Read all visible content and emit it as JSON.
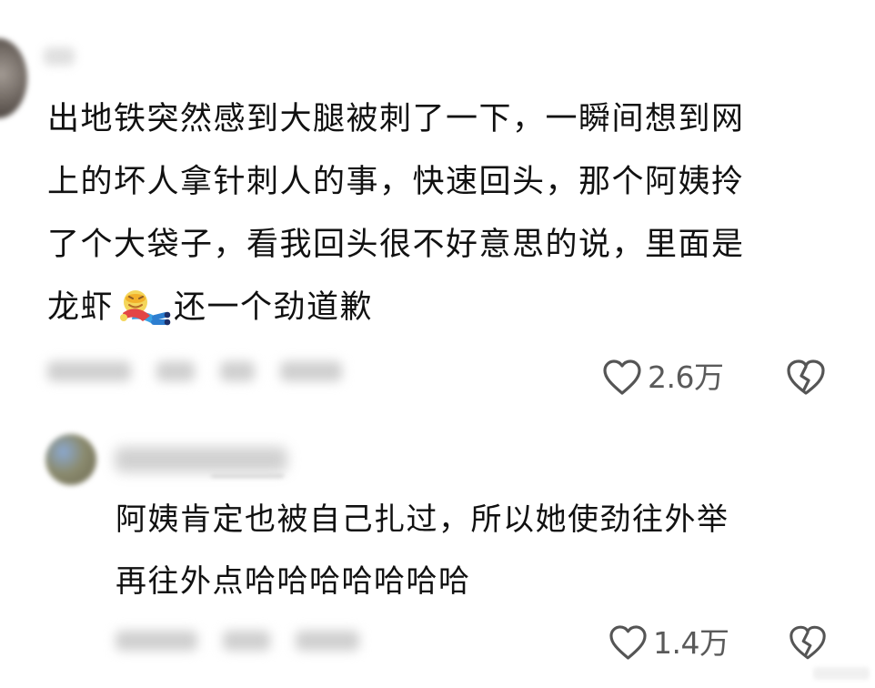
{
  "comment": {
    "text_before_emoji": "出地铁突然感到大腿被刺了一下，一瞬间想到网\n上的坏人拿针刺人的事，快速回头，那个阿姨拎\n了个大袋子，看我回头很不好意思的说，里面是\n龙虾",
    "emoji": "lying-down-person-emoji",
    "text_after_emoji": "还一个劲道歉",
    "like_count": "2.6万",
    "like_icon": "heart-outline-icon",
    "dislike_icon": "broken-heart-icon"
  },
  "reply": {
    "text": "阿姨肯定也被自己扎过，所以她使劲往外举\n再往外点哈哈哈哈哈哈哈",
    "like_count": "1.4万",
    "like_icon": "heart-outline-icon",
    "dislike_icon": "broken-heart-icon"
  },
  "colors": {
    "background": "#ffffff",
    "text": "#111111",
    "meta_text": "#5a5a5a",
    "blur": "#cfcfcf"
  }
}
